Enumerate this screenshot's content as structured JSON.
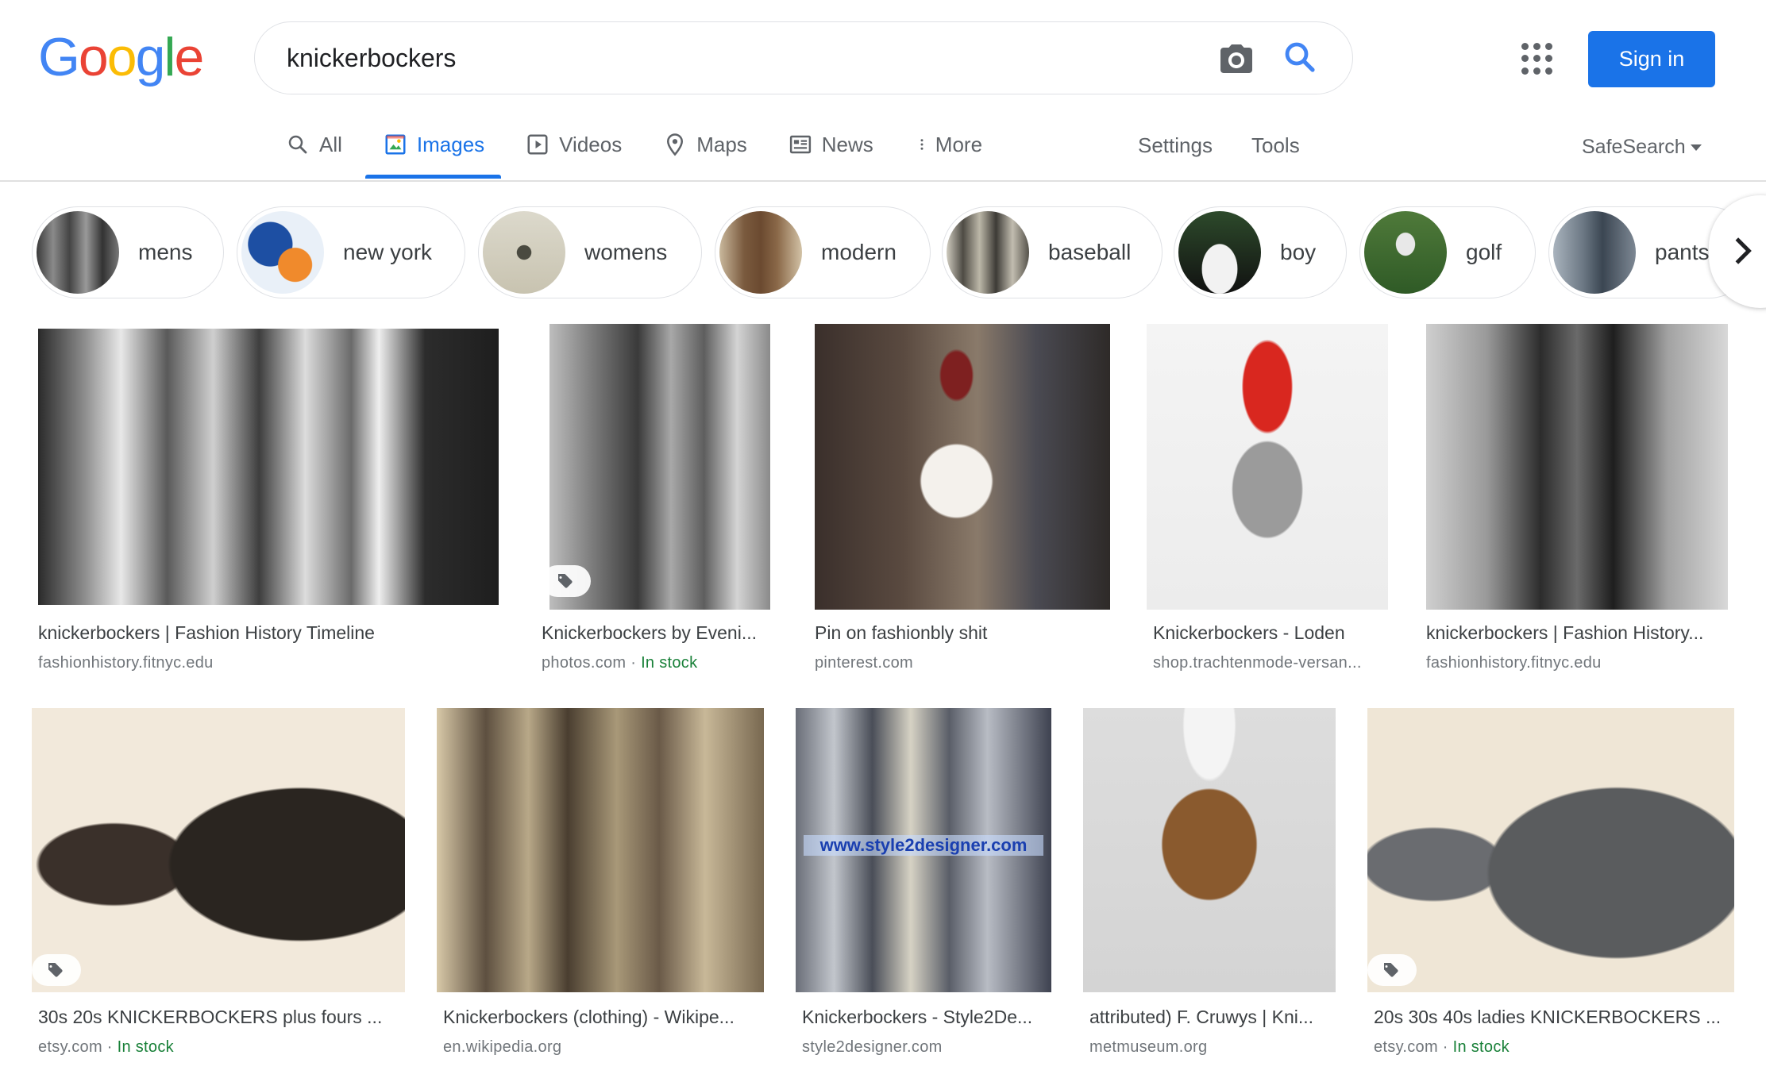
{
  "logo": {
    "G": "G",
    "o1": "o",
    "o2": "o",
    "g": "g",
    "l": "l",
    "e": "e"
  },
  "search": {
    "query": "knickerbockers"
  },
  "header": {
    "signin_label": "Sign in"
  },
  "tabs": [
    {
      "label": "All",
      "icon": "search-icon"
    },
    {
      "label": "Images",
      "icon": "image-icon"
    },
    {
      "label": "Videos",
      "icon": "play-icon"
    },
    {
      "label": "Maps",
      "icon": "map-pin-icon"
    },
    {
      "label": "News",
      "icon": "newspaper-icon"
    },
    {
      "label": "More",
      "icon": "vertical-dots-icon"
    }
  ],
  "tools": {
    "settings": "Settings",
    "tools": "Tools",
    "safesearch": "SafeSearch"
  },
  "chips": [
    "mens",
    "new york",
    "womens",
    "modern",
    "baseball",
    "boy",
    "golf",
    "pants"
  ],
  "results": [
    {
      "title": "knickerbockers | Fashion History Timeline",
      "source": "fashionhistory.fitnyc.edu",
      "stock": ""
    },
    {
      "title": "Knickerbockers by Eveni...",
      "source": "photos.com",
      "stock": "In stock"
    },
    {
      "title": "Pin on fashionbly shit",
      "source": "pinterest.com",
      "stock": ""
    },
    {
      "title": "Knickerbockers - Loden",
      "source": "shop.trachtenmode-versan...",
      "stock": ""
    },
    {
      "title": "knickerbockers | Fashion History...",
      "source": "fashionhistory.fitnyc.edu",
      "stock": ""
    },
    {
      "title": "30s 20s KNICKERBOCKERS plus fours ...",
      "source": "etsy.com",
      "stock": "In stock"
    },
    {
      "title": "Knickerbockers (clothing) - Wikipe...",
      "source": "en.wikipedia.org",
      "stock": ""
    },
    {
      "title": "Knickerbockers - Style2De...",
      "source": "style2designer.com",
      "stock": ""
    },
    {
      "title": "attributed) F. Cruwys | Kni...",
      "source": "metmuseum.org",
      "stock": ""
    },
    {
      "title": "20s 30s 40s ladies KNICKERBOCKERS ...",
      "source": "etsy.com",
      "stock": "In stock"
    }
  ],
  "overlay_text": {
    "watermark": "www.style2designer.com"
  },
  "colors": {
    "accent": "#1a73e8",
    "in_stock": "#188038"
  }
}
